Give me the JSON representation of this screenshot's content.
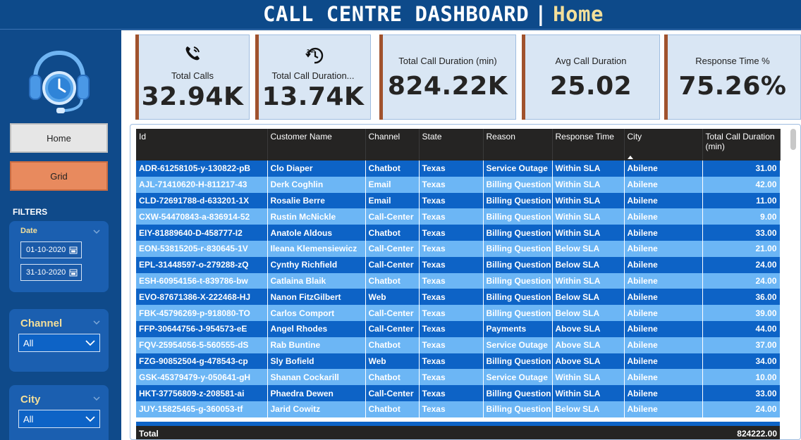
{
  "header": {
    "title": "CALL CENTRE DASHBOARD",
    "separator": "|",
    "page": "Home"
  },
  "sidebar": {
    "logo": "headset-clock-icon",
    "nav": {
      "home": "Home",
      "grid": "Grid"
    },
    "filters_label": "FILTERS",
    "date_filter": {
      "label": "Date",
      "start": "01-10-2020",
      "end": "31-10-2020"
    },
    "channel_filter": {
      "label": "Channel",
      "value": "All"
    },
    "city_filter": {
      "label": "City",
      "value": "All"
    }
  },
  "kpis": [
    {
      "label": "Total Calls",
      "value": "32.94K",
      "icon": "phone-icon"
    },
    {
      "label": "Total Call Duration (hrs)",
      "label_display": "Total Call Duration...",
      "value": "13.74K",
      "icon": "24h-clock-icon"
    },
    {
      "label": "Total Call Duration (min)",
      "value": "824.22K"
    },
    {
      "label": "Avg Call Duration",
      "value": "25.02"
    },
    {
      "label": "Response Time %",
      "value": "75.26%"
    }
  ],
  "table": {
    "columns": [
      "Id",
      "Customer Name",
      "Channel",
      "State",
      "Reason",
      "Response Time",
      "City",
      "Total Call Duration (min)"
    ],
    "sorted_column": "City",
    "rows": [
      [
        "ADR-61258105-y-130822-pB",
        "Clo Diaper",
        "Chatbot",
        "Texas",
        "Service Outage",
        "Within SLA",
        "Abilene",
        "31.00"
      ],
      [
        "AJL-71410620-H-811217-43",
        "Derk Coghlin",
        "Email",
        "Texas",
        "Billing Question",
        "Within SLA",
        "Abilene",
        "42.00"
      ],
      [
        "CLD-72691788-d-633201-1X",
        "Rosalie Berre",
        "Email",
        "Texas",
        "Billing Question",
        "Within SLA",
        "Abilene",
        "11.00"
      ],
      [
        "CXW-54470843-a-836914-52",
        "Rustin McNickle",
        "Call-Center",
        "Texas",
        "Billing Question",
        "Within SLA",
        "Abilene",
        "9.00"
      ],
      [
        "EIY-81889640-D-458777-I2",
        "Anatole Aldous",
        "Chatbot",
        "Texas",
        "Billing Question",
        "Within SLA",
        "Abilene",
        "33.00"
      ],
      [
        "EON-53815205-r-830645-1V",
        "Ileana Klemensiewicz",
        "Call-Center",
        "Texas",
        "Billing Question",
        "Below SLA",
        "Abilene",
        "21.00"
      ],
      [
        "EPL-31448597-o-279288-zQ",
        "Cynthy Richfield",
        "Call-Center",
        "Texas",
        "Billing Question",
        "Below SLA",
        "Abilene",
        "24.00"
      ],
      [
        "ESH-60954156-t-839786-bw",
        "Catlaina Blaik",
        "Chatbot",
        "Texas",
        "Billing Question",
        "Within SLA",
        "Abilene",
        "24.00"
      ],
      [
        "EVO-87671386-X-222468-HJ",
        "Nanon FitzGilbert",
        "Web",
        "Texas",
        "Billing Question",
        "Below SLA",
        "Abilene",
        "36.00"
      ],
      [
        "FBK-45796269-p-918080-TO",
        "Carlos Comport",
        "Call-Center",
        "Texas",
        "Billing Question",
        "Below SLA",
        "Abilene",
        "39.00"
      ],
      [
        "FFP-30644756-J-954573-eE",
        "Angel Rhodes",
        "Call-Center",
        "Texas",
        "Payments",
        "Above SLA",
        "Abilene",
        "44.00"
      ],
      [
        "FQV-25954056-5-560555-dS",
        "Rab Buntine",
        "Chatbot",
        "Texas",
        "Service Outage",
        "Above SLA",
        "Abilene",
        "37.00"
      ],
      [
        "FZG-90852504-g-478543-cp",
        "Sly Bofield",
        "Web",
        "Texas",
        "Billing Question",
        "Above SLA",
        "Abilene",
        "34.00"
      ],
      [
        "GSK-45379479-y-050641-gH",
        "Shanan Cockarill",
        "Chatbot",
        "Texas",
        "Service Outage",
        "Within SLA",
        "Abilene",
        "10.00"
      ],
      [
        "HKT-37756809-z-208581-ai",
        "Phaedra Dewen",
        "Call-Center",
        "Texas",
        "Billing Question",
        "Within SLA",
        "Abilene",
        "33.00"
      ],
      [
        "JUY-15825465-g-360053-tf",
        "Jarid Cowitz",
        "Chatbot",
        "Texas",
        "Billing Question",
        "Below SLA",
        "Abilene",
        "24.00"
      ]
    ],
    "total_label": "Total",
    "total_value": "824222.00"
  },
  "colors": {
    "header_bg": "#0d4a8a",
    "accent_title": "#f3df9a",
    "grid_button": "#e88a5e",
    "row_dark": "#0d63c6",
    "row_light": "#6cb6f5",
    "kpi_accent": "#a0522d"
  }
}
